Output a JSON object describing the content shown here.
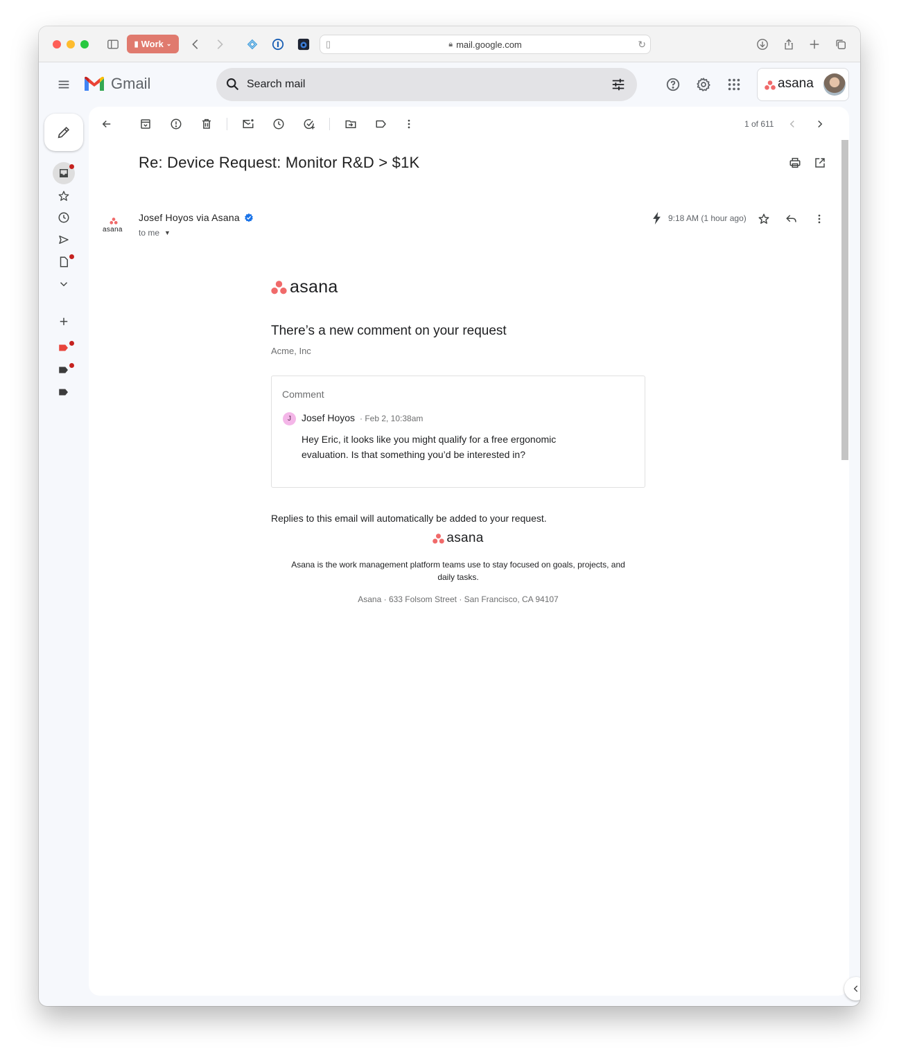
{
  "browser": {
    "profile_label": "Work",
    "address": "mail.google.com"
  },
  "gmail": {
    "app_name": "Gmail",
    "search_placeholder": "Search mail",
    "account_brand": "asana"
  },
  "toolbar": {
    "pagination": "1 of 611"
  },
  "message": {
    "subject": "Re: Device Request: Monitor R&D > $1K",
    "sender": "Josef Hoyos via Asana",
    "recipient": "to me",
    "time": "9:18 AM (1 hour ago)",
    "sender_avatar_text": "asana"
  },
  "email": {
    "brand": "asana",
    "headline": "There’s a new comment on your request",
    "org": "Acme, Inc",
    "card_title": "Comment",
    "author_initial": "J",
    "author": "Josef Hoyos",
    "date": "· Feb 2, 10:38am",
    "comment": "Hey Eric, it looks like you might qualify for a free ergonomic evaluation. Is that something you’d be interested in?",
    "replies_note": "Replies to this email will automatically be added to your request.",
    "footer_brand": "asana",
    "footer_desc": "Asana is the work management platform teams use to stay focused on goals, projects, and daily tasks.",
    "footer_address": "Asana · 633 Folsom Street · San Francisco, CA 94107"
  },
  "colors": {
    "asana_coral": "#f06a6a",
    "gmail_bg": "#f6f8fc",
    "unread_dot": "#c5221f"
  }
}
